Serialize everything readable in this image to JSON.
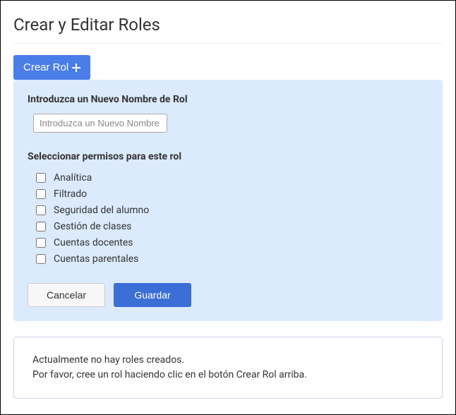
{
  "page": {
    "title": "Crear y Editar Roles"
  },
  "create_button": {
    "label": "Crear Rol"
  },
  "form": {
    "name_label": "Introduzca un Nuevo Nombre de Rol",
    "name_placeholder": "Introduzca un Nuevo Nombre de Rol",
    "permissions_label": "Seleccionar permisos para este rol",
    "permissions": [
      {
        "label": "Analítica",
        "checked": false
      },
      {
        "label": "Filtrado",
        "checked": false
      },
      {
        "label": "Seguridad del alumno",
        "checked": false
      },
      {
        "label": "Gestión de clases",
        "checked": false
      },
      {
        "label": "Cuentas docentes",
        "checked": false
      },
      {
        "label": "Cuentas parentales",
        "checked": false
      }
    ],
    "cancel_label": "Cancelar",
    "save_label": "Guardar"
  },
  "empty_state": {
    "line1": "Actualmente no hay roles creados.",
    "line2": "Por favor, cree un rol haciendo clic en el botón Crear Rol arriba."
  }
}
